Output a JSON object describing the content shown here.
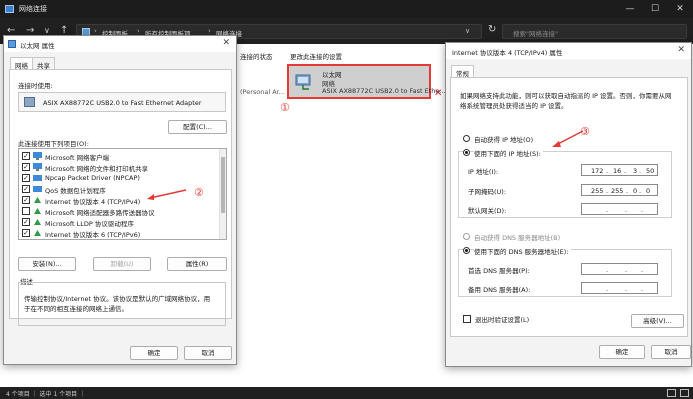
{
  "explorer": {
    "title": "网络连接",
    "breadcrumb": [
      "控制面板",
      "所有控制面板项",
      "网络连接"
    ],
    "search_placeholder": "搜索\"网络连接\"",
    "toolbar": [
      "连接的状态",
      "更改此连接的设置"
    ],
    "partial_adapter_text": "(Personal Ar...",
    "adapter": {
      "name": "以太网",
      "type": "网络",
      "device": "ASIX AX88772C USB2.0 to Fast Ethe..."
    },
    "status": "4 个项目 ｜ 选中 1 个项目 ｜"
  },
  "annotations": {
    "one": "①",
    "two": "②",
    "three": "③",
    "color": "#e53935"
  },
  "eth_dialog": {
    "title": "以太网 属性",
    "tabs": [
      "网络",
      "共享"
    ],
    "connect_using_label": "连接时使用:",
    "adapter": "ASIX AX88772C USB2.0 to Fast Ethernet Adapter",
    "configure_button": "配置(C)...",
    "items_label": "此连接使用下列项目(O):",
    "items": [
      {
        "label": "Microsoft 网络客户端",
        "checked": true
      },
      {
        "label": "Microsoft 网络的文件和打印机共享",
        "checked": true
      },
      {
        "label": "Npcap Packet Driver (NPCAP)",
        "checked": true
      },
      {
        "label": "QoS 数据包计划程序",
        "checked": true
      },
      {
        "label": "Internet 协议版本 4 (TCP/IPv4)",
        "checked": true
      },
      {
        "label": "Microsoft 网络适配器多路传送器协议",
        "checked": false
      },
      {
        "label": "Microsoft LLDP 协议驱动程序",
        "checked": true
      },
      {
        "label": "Internet 协议版本 6 (TCP/IPv6)",
        "checked": true
      }
    ],
    "install_button": "安装(N)...",
    "uninstall_button": "卸载(U)",
    "properties_button": "属性(R)",
    "desc_title": "描述",
    "desc_line1": "传输控制协议/Internet 协议。该协议是默认的广域网络协议，用",
    "desc_line2": "于在不同的相互连接的网络上通信。",
    "ok_button": "确定",
    "cancel_button": "取消"
  },
  "ipv4_dialog": {
    "title": "Internet 协议版本 4 (TCP/IPv4) 属性",
    "tab": "常规",
    "intro_line1": "如果网络支持此功能，则可以获取自动指派的 IP 设置。否则，你需要从网",
    "intro_line2": "络系统管理员处获得适当的 IP 设置。",
    "auto_ip": "自动获得 IP 地址(O)",
    "manual_ip": "使用下面的 IP 地址(S):",
    "ip_label": "IP 地址(I):",
    "mask_label": "子网掩码(U):",
    "gateway_label": "默认网关(D):",
    "ip_octets": [
      "172",
      "16",
      "3",
      "50"
    ],
    "mask_octets": [
      "255",
      "255",
      "0",
      "0"
    ],
    "empty_octets": [
      ".",
      ".",
      "."
    ],
    "auto_dns": "自动获得 DNS 服务器地址(B)",
    "manual_dns": "使用下面的 DNS 服务器地址(E):",
    "pref_dns_label": "首选 DNS 服务器(P):",
    "alt_dns_label": "备用 DNS 服务器(A):",
    "validate_label": "退出时验证设置(L)",
    "advanced_button": "高级(V)...",
    "ok_button": "确定",
    "cancel_button": "取消"
  }
}
